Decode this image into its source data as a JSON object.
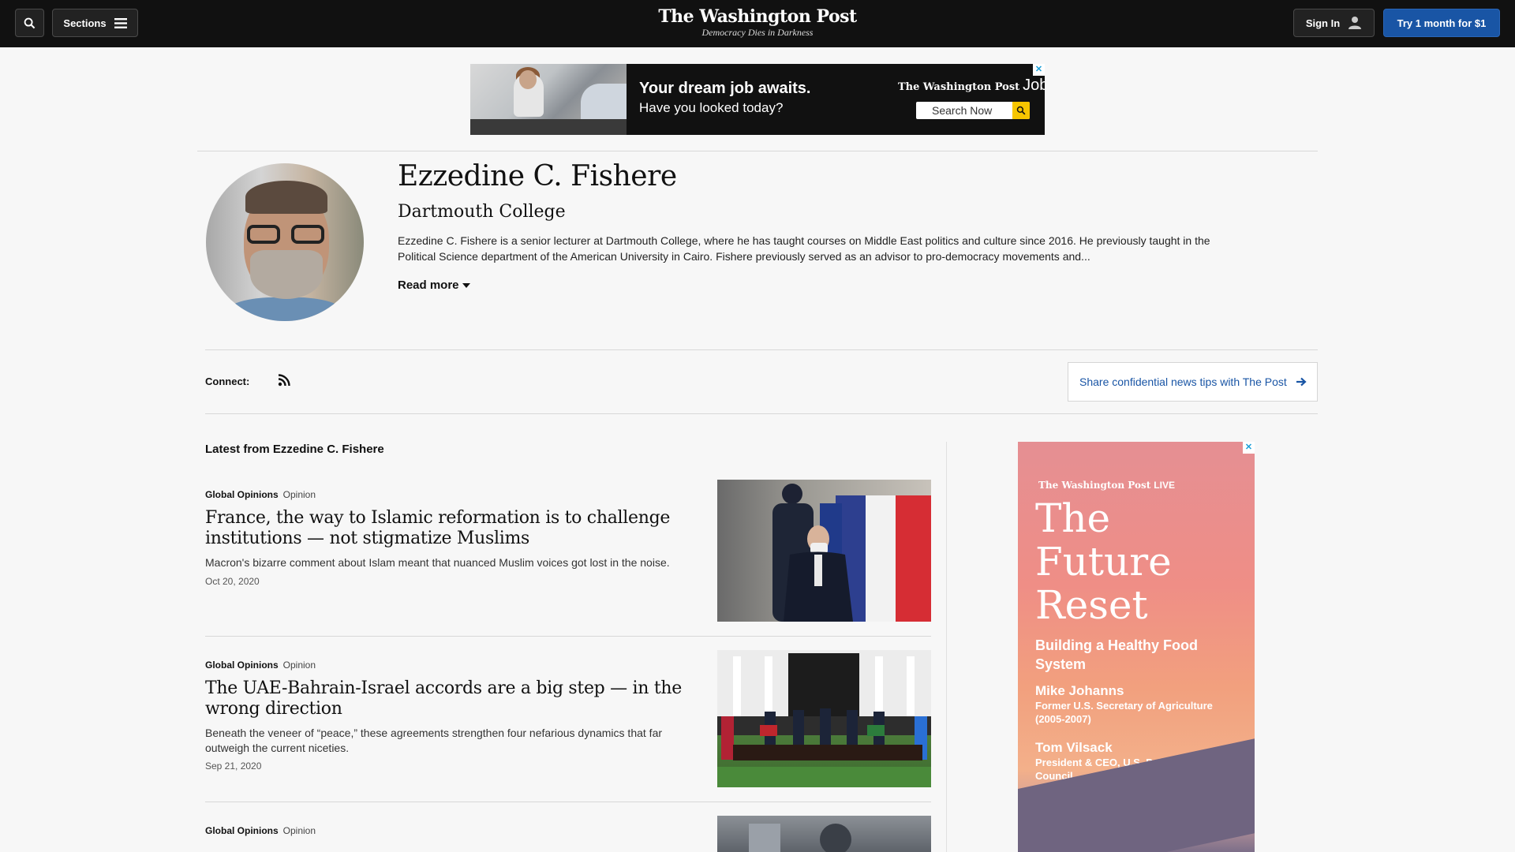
{
  "nav": {
    "sections_label": "Sections",
    "signin_label": "Sign In",
    "try_label": "Try 1 month for $1",
    "masthead": "The Washington Post",
    "tagline": "Democracy Dies in Darkness"
  },
  "top_ad": {
    "headline": "Your dream job awaits.",
    "sub": "Have you looked today?",
    "brand": "The Washington Post",
    "brand_suffix": "Jobs",
    "search_label": "Search Now",
    "close": "✕"
  },
  "author": {
    "name": "Ezzedine C. Fishere",
    "affiliation": "Dartmouth College",
    "bio": "Ezzedine C. Fishere is a senior lecturer at Dartmouth College, where he has taught courses on Middle East politics and culture since 2016. He previously taught in the Political Science department of the American University in Cairo. Fishere previously served as an advisor to pro-democracy movements and...",
    "read_more": "Read more"
  },
  "connect": {
    "label": "Connect:",
    "tips": "Share confidential news tips with The Post"
  },
  "latest": {
    "title": "Latest from Ezzedine C. Fishere",
    "articles": [
      {
        "section": "Global Opinions",
        "label": "Opinion",
        "headline": "France, the way to Islamic reformation is to challenge institutions — not stigmatize Muslims",
        "blurb": "Macron's bizarre comment about Islam meant that nuanced Muslim voices got lost in the noise.",
        "date": "Oct 20, 2020"
      },
      {
        "section": "Global Opinions",
        "label": "Opinion",
        "headline": "The UAE-Bahrain-Israel accords are a big step — in the wrong direction",
        "blurb": "Beneath the veneer of “peace,” these agreements strengthen four nefarious dynamics that far outweigh the current niceties.",
        "date": "Sep 21, 2020"
      },
      {
        "section": "Global Opinions",
        "label": "Opinion",
        "headline": "",
        "blurb": "",
        "date": ""
      }
    ]
  },
  "side_ad": {
    "brand": "The Washington Post",
    "brand_suffix": "LIVE",
    "title": "The Future Reset",
    "subtitle": "Building a Healthy Food System",
    "speaker1_name": "Mike Johanns",
    "speaker1_title": "Former U.S. Secretary of Agriculture (2005-2007)",
    "speaker2_name": "Tom Vilsack",
    "speaker2_title": "President & CEO, U.S. Dairy Export Council",
    "close": "✕"
  }
}
